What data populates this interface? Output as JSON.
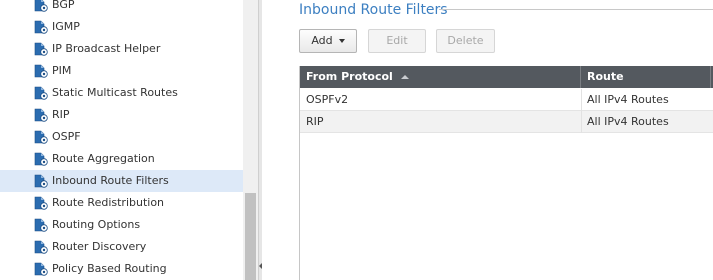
{
  "sidebar": {
    "items": [
      {
        "label": "BGP",
        "icon": "protocol-node-icon",
        "selected": false
      },
      {
        "label": "IGMP",
        "icon": "protocol-node-icon",
        "selected": false
      },
      {
        "label": "IP Broadcast Helper",
        "icon": "protocol-node-icon",
        "selected": false
      },
      {
        "label": "PIM",
        "icon": "protocol-node-icon",
        "selected": false
      },
      {
        "label": "Static Multicast Routes",
        "icon": "protocol-node-icon",
        "selected": false
      },
      {
        "label": "RIP",
        "icon": "protocol-node-icon",
        "selected": false
      },
      {
        "label": "OSPF",
        "icon": "protocol-node-icon",
        "selected": false
      },
      {
        "label": "Route Aggregation",
        "icon": "protocol-node-icon",
        "selected": false
      },
      {
        "label": "Inbound Route Filters",
        "icon": "protocol-node-icon",
        "selected": true
      },
      {
        "label": "Route Redistribution",
        "icon": "protocol-node-icon",
        "selected": false
      },
      {
        "label": "Routing Options",
        "icon": "protocol-node-icon",
        "selected": false
      },
      {
        "label": "Router Discovery",
        "icon": "protocol-node-icon",
        "selected": false
      },
      {
        "label": "Policy Based Routing",
        "icon": "protocol-node-icon",
        "selected": false
      }
    ]
  },
  "main": {
    "section_title": "Inbound Route Filters",
    "toolbar": {
      "add_label": "Add",
      "edit_label": "Edit",
      "delete_label": "Delete"
    },
    "grid": {
      "columns": [
        "From Protocol",
        "Route"
      ],
      "sort_column": "From Protocol",
      "sort_direction": "ascending",
      "rows": [
        {
          "protocol": "OSPFv2",
          "route": "All IPv4 Routes"
        },
        {
          "protocol": "RIP",
          "route": "All IPv4 Routes"
        }
      ]
    }
  },
  "colors": {
    "accent": "#3c7fc1",
    "selection": "#dde9f8",
    "grid_header": "#54595f"
  }
}
